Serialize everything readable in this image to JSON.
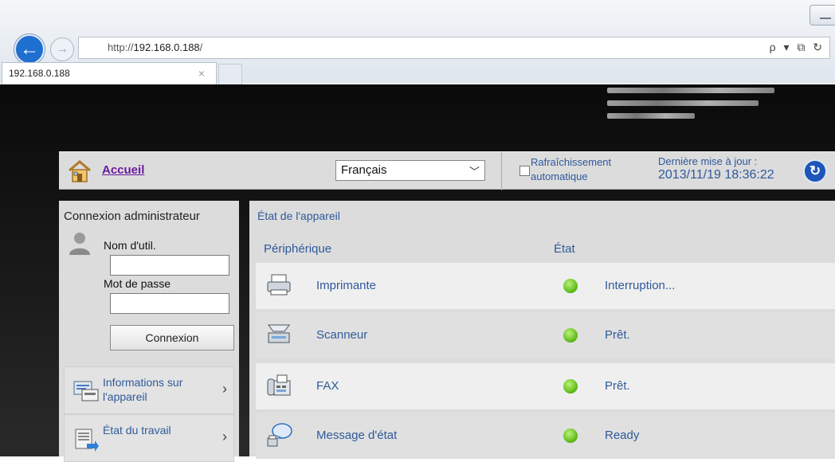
{
  "browser": {
    "url_prefix": "http://",
    "url_host": "192.168.0.188",
    "url_suffix": "/",
    "tab_title": "192.168.0.188",
    "tab_close": "×",
    "address_tools": "ρ ▾ ⧉ ↻"
  },
  "header": {
    "home_label": "Accueil",
    "language": "Français",
    "auto_refresh": "Rafraîchissement\nautomatique",
    "last_update_label": "Dernière mise à jour :",
    "last_update_value": "2013/11/19 18:36:22"
  },
  "login": {
    "title": "Connexion administrateur",
    "username_label": "Nom d'util.",
    "password_label": "Mot de passe",
    "login_button": "Connexion"
  },
  "sidebar": {
    "items": [
      {
        "label": "Informations sur l'appareil",
        "icon": "device-info-icon"
      },
      {
        "label": "État du travail",
        "icon": "job-status-icon"
      }
    ]
  },
  "device_status": {
    "title": "État de l'appareil",
    "col_device": "Périphérique",
    "col_state": "État",
    "rows": [
      {
        "name": "Imprimante",
        "state": "Interruption...",
        "icon": "printer-icon",
        "status_color": "#66bf1f"
      },
      {
        "name": "Scanneur",
        "state": "Prêt.",
        "icon": "scanner-icon",
        "status_color": "#66bf1f"
      },
      {
        "name": "FAX",
        "state": "Prêt.",
        "icon": "fax-icon",
        "status_color": "#66bf1f"
      },
      {
        "name": "Message d'état",
        "state": "Ready",
        "icon": "message-icon",
        "status_color": "#66bf1f"
      }
    ]
  },
  "colors": {
    "link_blue": "#2f5a9a",
    "home_link_purple": "#6a1aa0",
    "panel_gray": "#dcdcdc",
    "page_dark": "#111111"
  }
}
